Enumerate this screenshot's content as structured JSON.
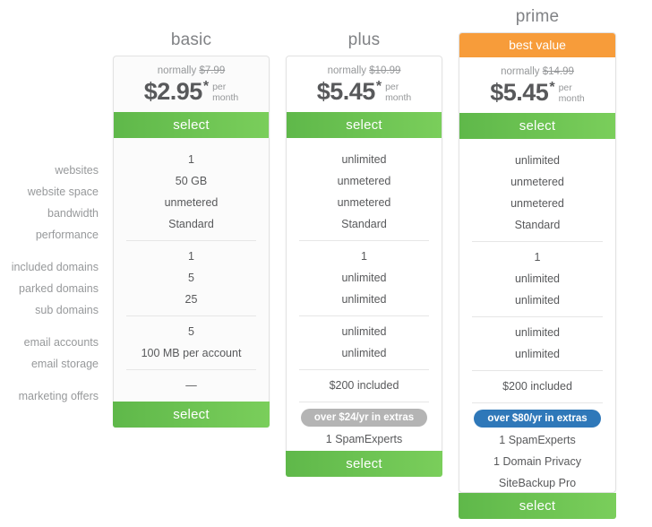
{
  "feature_labels": [
    [
      "websites",
      "website space",
      "bandwidth",
      "performance"
    ],
    [
      "included domains",
      "parked domains",
      "sub domains"
    ],
    [
      "email accounts",
      "email storage"
    ],
    [
      "marketing offers"
    ]
  ],
  "select_label": "select",
  "plans": {
    "basic": {
      "title": "basic",
      "badge_header": "",
      "normally_prefix": "normally ",
      "normally_price": "$7.99",
      "price": "$2.95",
      "star": "*",
      "per": "per",
      "month": "month",
      "features": {
        "websites": "1",
        "website_space": "50 GB",
        "bandwidth": "unmetered",
        "performance": "Standard",
        "included_domains": "1",
        "parked_domains": "5",
        "sub_domains": "25",
        "email_accounts": "5",
        "email_storage": "100 MB per account",
        "marketing_offers": "—"
      },
      "extras_badge": "",
      "extras_items": []
    },
    "plus": {
      "title": "plus",
      "badge_header": "",
      "normally_prefix": "normally ",
      "normally_price": "$10.99",
      "price": "$5.45",
      "star": "*",
      "per": "per",
      "month": "month",
      "features": {
        "websites": "unlimited",
        "website_space": "unmetered",
        "bandwidth": "unmetered",
        "performance": "Standard",
        "included_domains": "1",
        "parked_domains": "unlimited",
        "sub_domains": "unlimited",
        "email_accounts": "unlimited",
        "email_storage": "unlimited",
        "marketing_offers": "$200 included"
      },
      "extras_badge": "over $24/yr in extras",
      "extras_badge_color": "#b4b4b4",
      "extras_items": [
        "1 SpamExperts"
      ]
    },
    "prime": {
      "title": "prime",
      "badge_header": "best value",
      "badge_header_color": "#f79c3a",
      "normally_prefix": "normally ",
      "normally_price": "$14.99",
      "price": "$5.45",
      "star": "*",
      "per": "per",
      "month": "month",
      "features": {
        "websites": "unlimited",
        "website_space": "unmetered",
        "bandwidth": "unmetered",
        "performance": "Standard",
        "included_domains": "1",
        "parked_domains": "unlimited",
        "sub_domains": "unlimited",
        "email_accounts": "unlimited",
        "email_storage": "unlimited",
        "marketing_offers": "$200 included"
      },
      "extras_badge": "over $80/yr in extras",
      "extras_badge_color": "#2f78b9",
      "extras_items": [
        "1 SpamExperts",
        "1 Domain Privacy",
        "SiteBackup Pro"
      ]
    }
  },
  "colors": {
    "select_green_start": "#5fb84a",
    "select_green_end": "#7ace5b",
    "best_value_orange": "#f79c3a",
    "badge_gray": "#b4b4b4",
    "badge_blue": "#2f78b9",
    "text": "#58595b",
    "muted": "#97999b"
  }
}
